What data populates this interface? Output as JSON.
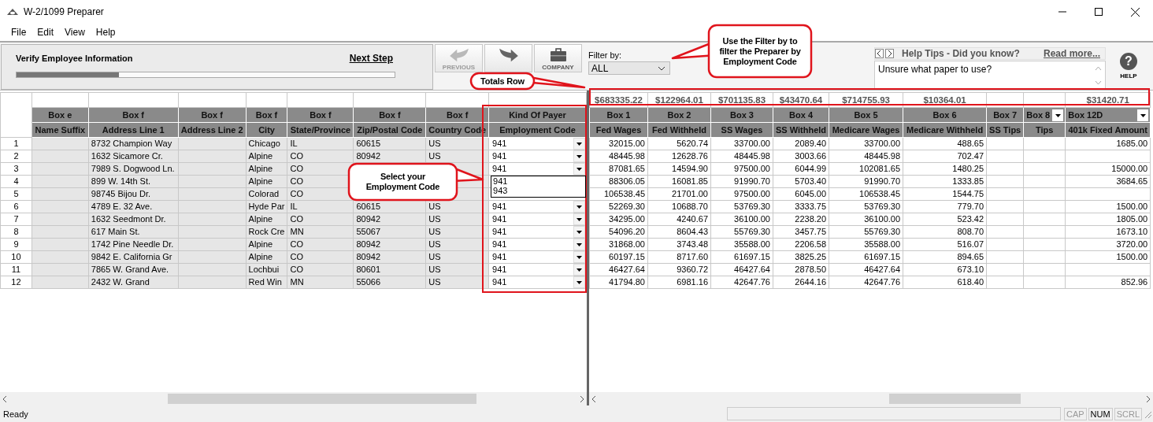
{
  "window": {
    "title": "W-2/1099 Preparer"
  },
  "menu": [
    "File",
    "Edit",
    "View",
    "Help"
  ],
  "step_panel": {
    "title": "Verify Employee Information",
    "next_link": "Next Step",
    "level": 0.27
  },
  "toolbar": [
    {
      "kind": "previous",
      "label": "PREVIOUS",
      "disabled": true
    },
    {
      "kind": "next",
      "disabled": false
    },
    {
      "kind": "company",
      "label": "COMPANY",
      "disabled": false
    }
  ],
  "filter": {
    "label": "Filter by:",
    "value": "ALL"
  },
  "help_tips": {
    "title": "Help Tips - Did you know?",
    "link": "Read more...",
    "text": "Unsure what paper to use?"
  },
  "help_button": {
    "glyph": "?",
    "label": "HELP"
  },
  "left_grid": {
    "columns": [
      {
        "group": "Box e",
        "name": "Name Suffix"
      },
      {
        "group": "Box f",
        "name": "Address Line 1"
      },
      {
        "group": "Box f",
        "name": "Address Line 2"
      },
      {
        "group": "Box f",
        "name": "City"
      },
      {
        "group": "Box f",
        "name": "State/Province"
      },
      {
        "group": "Box f",
        "name": "Zip/Postal Code"
      },
      {
        "group": "Box f",
        "name": "Country Code"
      },
      {
        "group": "Kind Of Payer",
        "name": "Employment Code"
      }
    ],
    "rows": [
      {
        "num": "1",
        "cells": [
          null,
          "8732 Champion Way",
          null,
          "Chicago",
          "IL",
          "60615",
          "US"
        ],
        "employment_code": "941"
      },
      {
        "num": "2",
        "cells": [
          null,
          "1632 Sicamore Cr.",
          null,
          "Alpine",
          "CO",
          "80942",
          "US"
        ],
        "employment_code": "941"
      },
      {
        "num": "3",
        "cells": [
          null,
          "7989 S. Dogwood Ln.",
          null,
          "Alpine",
          "CO",
          null,
          null
        ],
        "employment_code": "941"
      },
      {
        "num": "4",
        "cells": [
          null,
          "899 W. 14th St.",
          null,
          "Alpine",
          "CO",
          null,
          null
        ],
        "dropdown_options": [
          "941",
          "943"
        ]
      },
      {
        "num": "5",
        "cells": [
          null,
          "98745 Bijou Dr.",
          null,
          "Colorad",
          "CO",
          null,
          null
        ]
      },
      {
        "num": "6",
        "cells": [
          null,
          "4789 E. 32 Ave.",
          null,
          "Hyde Par",
          "IL",
          "60615",
          "US"
        ],
        "employment_code": "941"
      },
      {
        "num": "7",
        "cells": [
          null,
          "1632 Seedmont Dr.",
          null,
          "Alpine",
          "CO",
          "80942",
          "US"
        ],
        "employment_code": "941"
      },
      {
        "num": "8",
        "cells": [
          null,
          "617 Main St.",
          null,
          "Rock Cre",
          "MN",
          "55067",
          "US"
        ],
        "employment_code": "941"
      },
      {
        "num": "9",
        "cells": [
          null,
          "1742 Pine Needle Dr.",
          null,
          "Alpine",
          "CO",
          "80942",
          "US"
        ],
        "employment_code": "941"
      },
      {
        "num": "10",
        "cells": [
          null,
          "9842 E. California Gr",
          null,
          "Alpine",
          "CO",
          "80942",
          "US"
        ],
        "employment_code": "941"
      },
      {
        "num": "11",
        "cells": [
          null,
          "7865 W. Grand Ave.",
          null,
          "Lochbui",
          "CO",
          "80601",
          "US"
        ],
        "employment_code": "941"
      },
      {
        "num": "12",
        "cells": [
          null,
          "2432 W. Grand",
          null,
          "Red Win",
          "MN",
          "55066",
          "US"
        ],
        "employment_code": "941"
      }
    ]
  },
  "right_grid": {
    "columns": [
      {
        "total": "$683335.22",
        "group": "Box 1",
        "name": "Fed Wages",
        "filter_menu": false
      },
      {
        "total": "$122964.01",
        "group": "Box 2",
        "name": "Fed Withheld",
        "filter_menu": false
      },
      {
        "total": "$701135.83",
        "group": "Box 3",
        "name": "SS Wages",
        "filter_menu": false
      },
      {
        "total": "$43470.64",
        "group": "Box 4",
        "name": "SS Withheld",
        "filter_menu": false
      },
      {
        "total": "$714755.93",
        "group": "Box 5",
        "name": "Medicare Wages",
        "filter_menu": false
      },
      {
        "total": "$10364.01",
        "group": "Box 6",
        "name": "Medicare Withheld",
        "filter_menu": false
      },
      {
        "group": "Box 7",
        "name": "SS Tips",
        "filter_menu": false
      },
      {
        "group": "Box 8",
        "name": "Tips",
        "filter_menu": true
      },
      {
        "total": "$31420.71",
        "group": "Box 12D",
        "name": "401k Fixed Amount",
        "filter_menu": true
      }
    ],
    "rows": [
      [
        "32015.00",
        "5620.74",
        "33700.00",
        "2089.40",
        "33700.00",
        "488.65",
        null,
        null,
        "1685.00"
      ],
      [
        "48445.98",
        "12628.76",
        "48445.98",
        "3003.66",
        "48445.98",
        "702.47",
        null,
        null,
        null
      ],
      [
        "87081.65",
        "14594.90",
        "97500.00",
        "6044.99",
        "102081.65",
        "1480.25",
        null,
        null,
        "15000.00"
      ],
      [
        "88306.05",
        "16081.85",
        "91990.70",
        "5703.40",
        "91990.70",
        "1333.85",
        null,
        null,
        "3684.65"
      ],
      [
        "106538.45",
        "21701.00",
        "97500.00",
        "6045.00",
        "106538.45",
        "1544.75",
        null,
        null,
        null
      ],
      [
        "52269.30",
        "10688.70",
        "53769.30",
        "3333.75",
        "53769.30",
        "779.70",
        null,
        null,
        "1500.00"
      ],
      [
        "34295.00",
        "4240.67",
        "36100.00",
        "2238.20",
        "36100.00",
        "523.42",
        null,
        null,
        "1805.00"
      ],
      [
        "54096.20",
        "8604.43",
        "55769.30",
        "3457.75",
        "55769.30",
        "808.70",
        null,
        null,
        "1673.10"
      ],
      [
        "31868.00",
        "3743.48",
        "35588.00",
        "2206.58",
        "35588.00",
        "516.07",
        null,
        null,
        "3720.00"
      ],
      [
        "60197.15",
        "8717.60",
        "61697.15",
        "3825.25",
        "61697.15",
        "894.65",
        null,
        null,
        "1500.00"
      ],
      [
        "46427.64",
        "9360.72",
        "46427.64",
        "2878.50",
        "46427.64",
        "673.10",
        null,
        null,
        null
      ],
      [
        "41794.80",
        "6981.16",
        "42647.76",
        "2644.16",
        "42647.76",
        "618.40",
        null,
        null,
        "852.96"
      ]
    ]
  },
  "callouts": [
    {
      "kind": "totals",
      "text": "Totals Row"
    },
    {
      "kind": "filter",
      "text": "Use the Filter by to filter the Preparer by Employment Code"
    },
    {
      "kind": "select",
      "text": "Select your Employment Code"
    }
  ],
  "status_bar": {
    "text": "Ready",
    "indicators": [
      {
        "label": "CAP",
        "on": false
      },
      {
        "label": "NUM",
        "on": true
      },
      {
        "label": "SCRL",
        "on": false
      }
    ]
  }
}
